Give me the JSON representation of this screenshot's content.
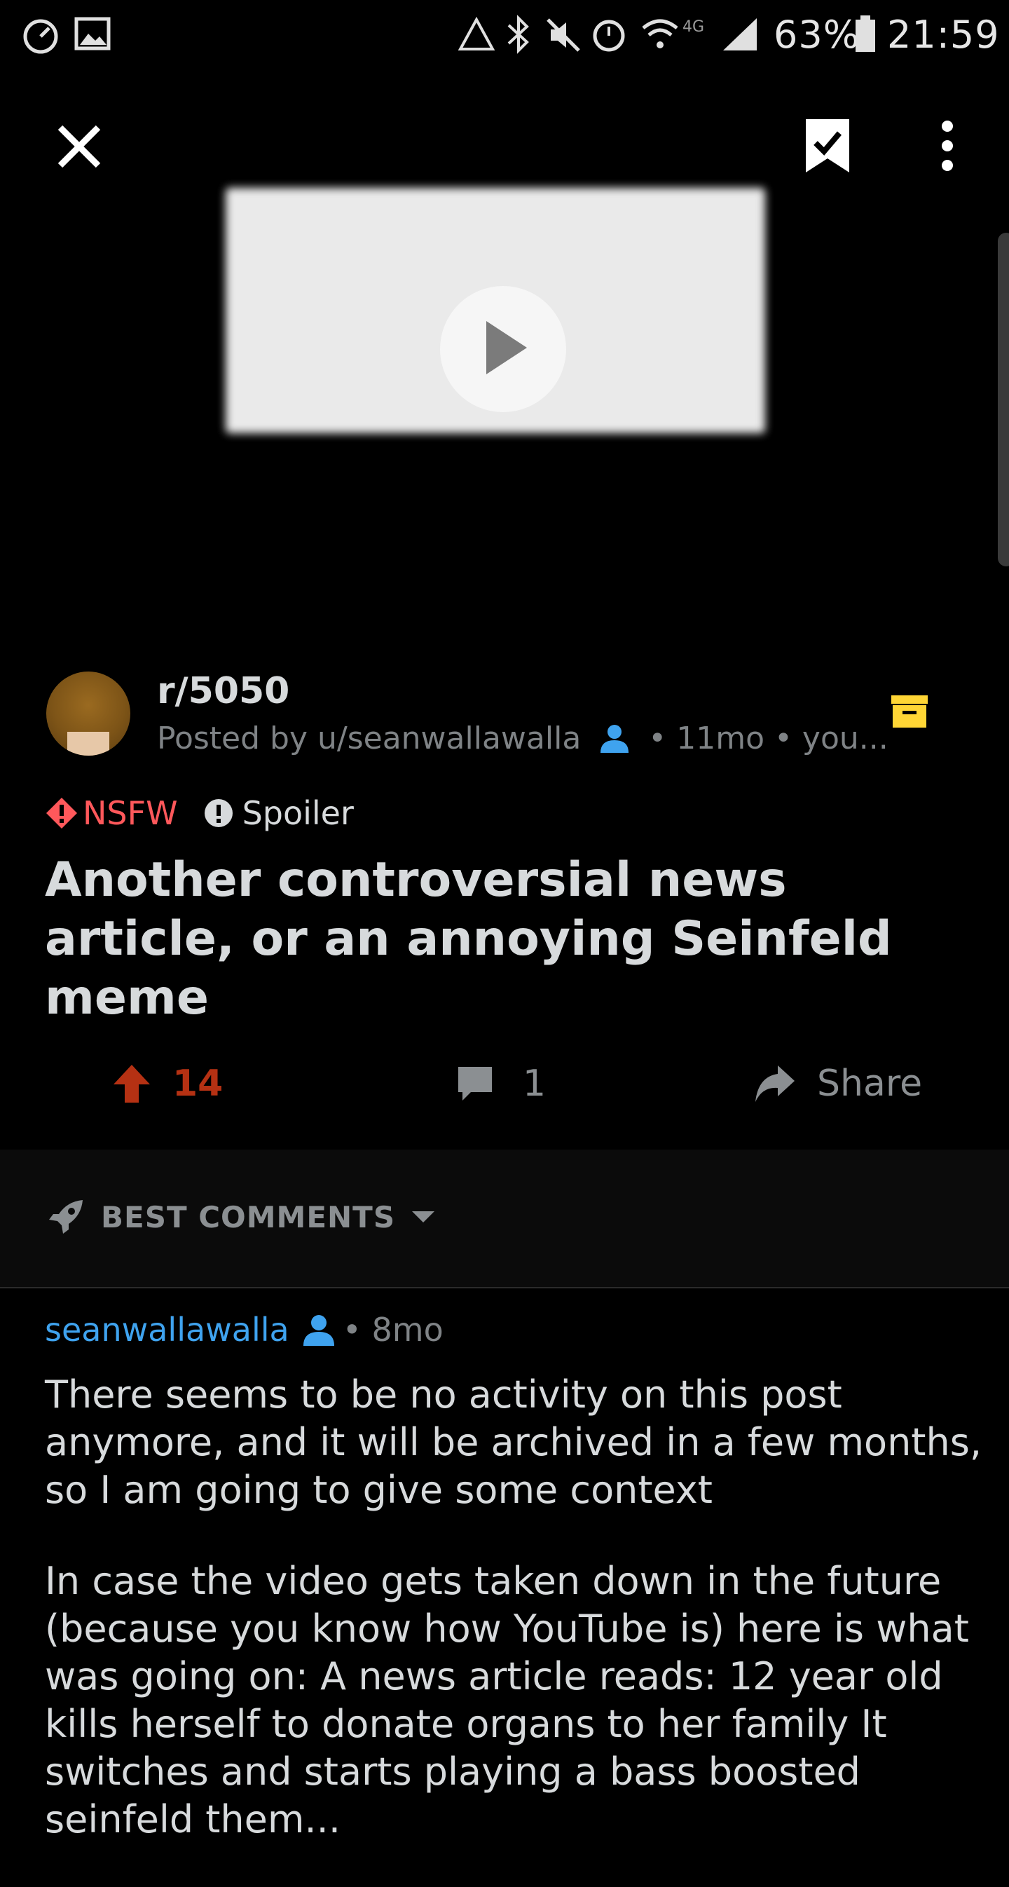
{
  "status_bar": {
    "battery": "63%",
    "time": "21:59",
    "network": "4G"
  },
  "top_bar": {
    "close_icon": "close-icon",
    "save_icon": "bookmark-check-icon",
    "more_icon": "more-vertical-icon"
  },
  "post": {
    "subreddit": "r/5050",
    "meta": "Posted by u/seanwallawalla",
    "meta_suffix": "• 11mo • you...",
    "nsfw_label": "NSFW",
    "spoiler_label": "Spoiler",
    "title": "Another controversial news article, or an annoying Seinfeld meme",
    "upvotes": "14",
    "comments": "1",
    "share_label": "Share"
  },
  "sort": {
    "label": "BEST COMMENTS"
  },
  "comment": {
    "author": "seanwallawalla",
    "time": "• 8mo",
    "paragraph1": "There seems to be no activity on this post anymore, and it will be archived in a few months, so I am going to give some context",
    "paragraph2": "In case the video gets taken down in the future (because you know how YouTube is) here is what was going on: A news article reads: 12 year old kills herself to donate organs to her family It switches and starts playing a bass boosted seinfeld them..."
  },
  "colors": {
    "upvote": "#b53113",
    "nsfw": "#ff585b",
    "username": "#3fa3ef",
    "archive": "#ffd635"
  }
}
